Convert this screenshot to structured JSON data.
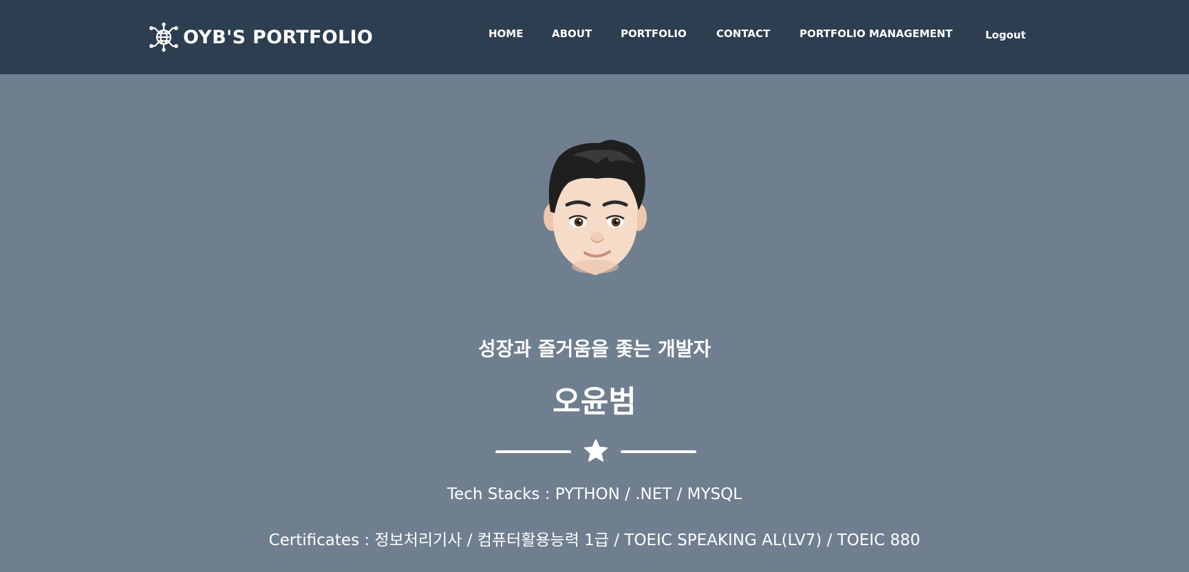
{
  "navbar": {
    "brand": {
      "icon": "globe-network-icon",
      "title": "OYB'S PORTFOLIO"
    },
    "links": [
      {
        "label": "HOME"
      },
      {
        "label": "ABOUT"
      },
      {
        "label": "PORTFOLIO"
      },
      {
        "label": "CONTACT"
      },
      {
        "label": "PORTFOLIO MANAGEMENT"
      },
      {
        "label": "Logout"
      }
    ]
  },
  "hero": {
    "avatar": "memoji-avatar",
    "subtitle": "성장과 즐거움을 좇는 개발자",
    "name": "오윤범",
    "divider_icon": "star-icon",
    "tech_stacks": "Tech Stacks : PYTHON / .NET / MYSQL",
    "certificates": "Certificates : 정보처리기사 / 컴퓨터활용능력 1급 / TOEIC SPEAKING AL(LV7) / TOEIC 880"
  },
  "colors": {
    "navbar_bg": "#2c3e50",
    "hero_bg": "#6f7f8f",
    "text": "#ffffff"
  }
}
